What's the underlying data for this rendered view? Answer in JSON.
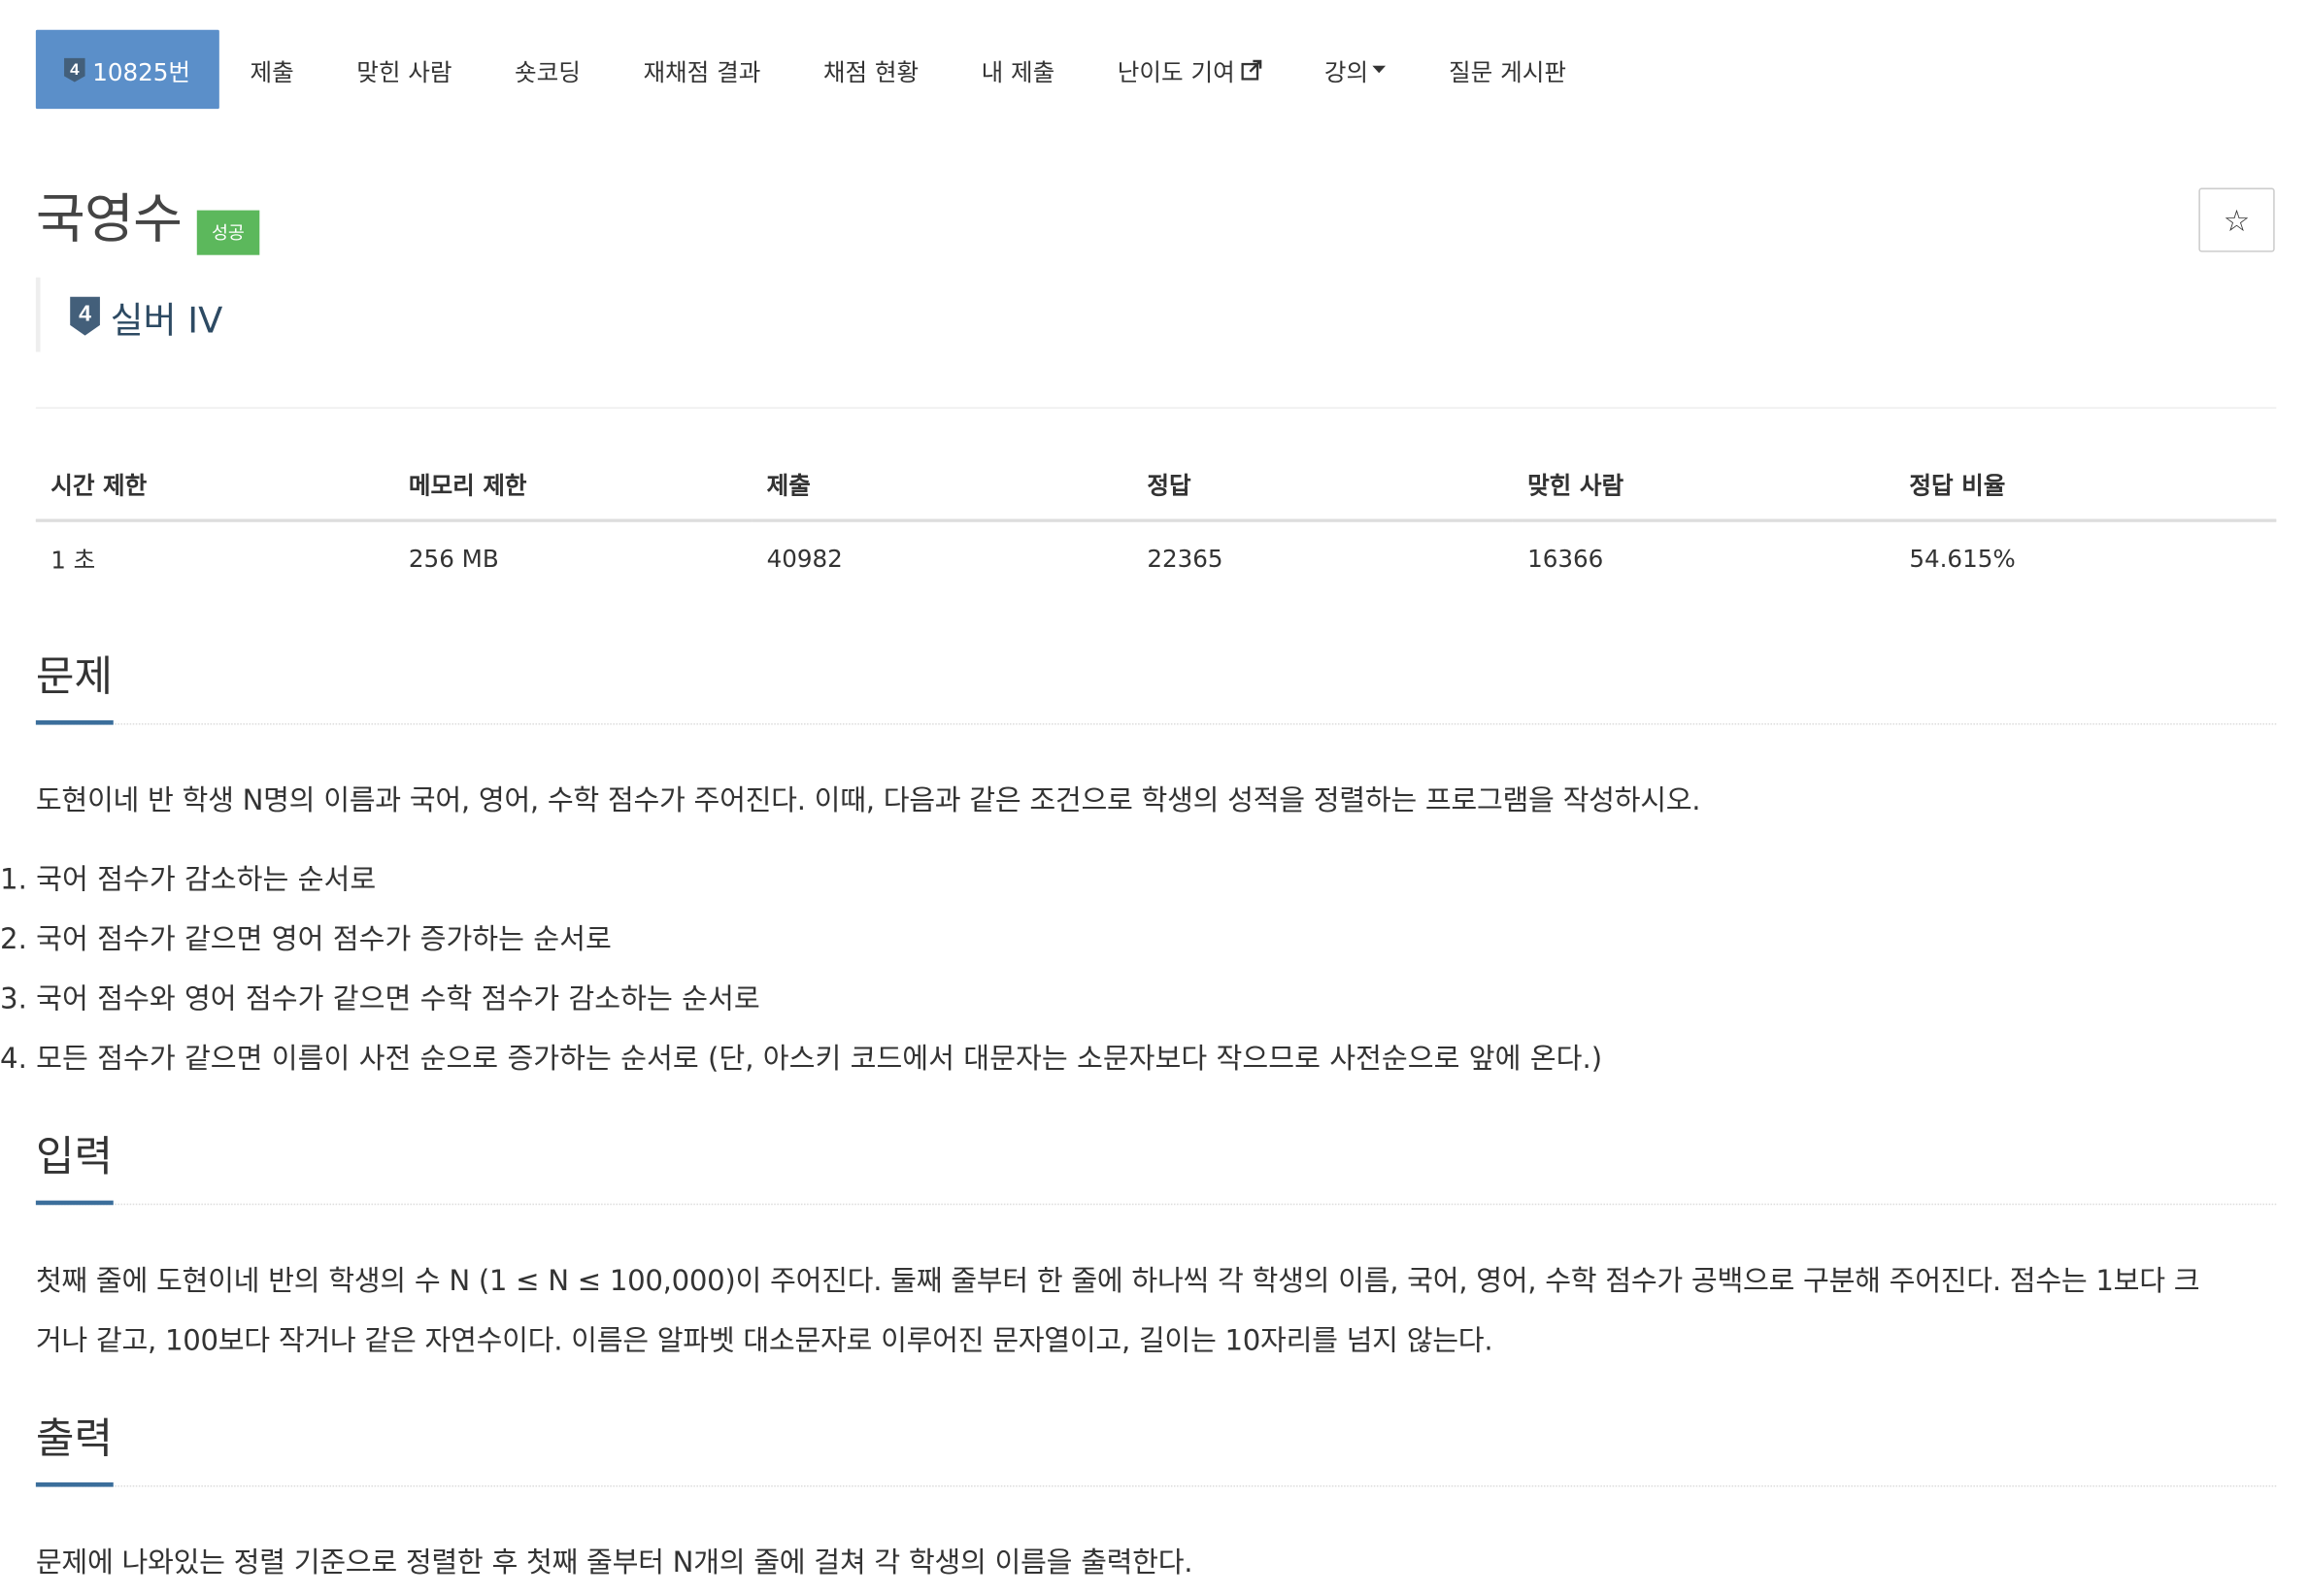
{
  "nav": {
    "problem_number": "10825번",
    "tier_digit": "4",
    "items": [
      {
        "label": "제출"
      },
      {
        "label": "맞힌 사람"
      },
      {
        "label": "숏코딩"
      },
      {
        "label": "재채점 결과"
      },
      {
        "label": "채점 현황"
      },
      {
        "label": "내 제출"
      },
      {
        "label": "난이도 기여"
      },
      {
        "label": "강의"
      },
      {
        "label": "질문 게시판"
      }
    ]
  },
  "problem": {
    "title": "국영수",
    "status": "성공",
    "tier_digit": "4",
    "tier": "실버 IV",
    "star": "☆"
  },
  "info": {
    "headers": [
      "시간 제한",
      "메모리 제한",
      "제출",
      "정답",
      "맞힌 사람",
      "정답 비율"
    ],
    "values": [
      "1 초",
      "256 MB",
      "40982",
      "22365",
      "16366",
      "54.615%"
    ]
  },
  "sections": {
    "description": {
      "title": "문제",
      "text": "도현이네 반 학생 N명의 이름과 국어, 영어, 수학 점수가 주어진다. 이때, 다음과 같은 조건으로 학생의 성적을 정렬하는 프로그램을 작성하시오.",
      "list": [
        "1. 국어 점수가 감소하는 순서로",
        "2. 국어 점수가 같으면 영어 점수가 증가하는 순서로",
        "3. 국어 점수와 영어 점수가 같으면 수학 점수가 감소하는 순서로",
        "4. 모든 점수가 같으면 이름이 사전 순으로 증가하는 순서로 (단, 아스키 코드에서 대문자는 소문자보다 작으므로 사전순으로 앞에 온다.)"
      ]
    },
    "input": {
      "title": "입력",
      "line1": "첫째 줄에 도현이네 반의 학생의 수 N (1 ≤ N ≤ 100,000)이 주어진다. 둘째 줄부터 한 줄에 하나씩 각 학생의 이름, 국어, 영어, 수학 점수가 공백으로 구분해 주어진다. 점수는 1보다 크",
      "line2": "거나 같고, 100보다 작거나 같은 자연수이다. 이름은 알파벳 대소문자로 이루어진 문자열이고, 길이는 10자리를 넘지 않는다."
    },
    "output": {
      "title": "출력",
      "text": "문제에 나와있는 정렬 기준으로 정렬한 후 첫째 줄부터 N개의 줄에 걸쳐 각 학생의 이름을 출력한다."
    }
  },
  "colors": {
    "nav_active": "#5b8fc9",
    "success_badge": "#5cb85c",
    "tier_badge": "#435f7a",
    "section_underline": "#3b6e9b"
  }
}
